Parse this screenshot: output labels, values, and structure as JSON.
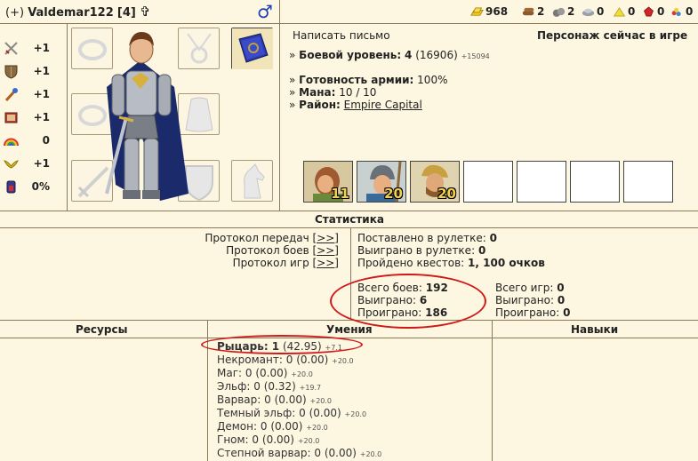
{
  "header": {
    "prefix": "(+)",
    "name": "Valdemar122",
    "level": "[4]",
    "cross": "✞",
    "gender": "♂"
  },
  "resources_top": [
    {
      "icon": "gold-icon",
      "value": "968"
    },
    {
      "icon": "wood-icon",
      "value": "2"
    },
    {
      "icon": "ore-icon",
      "value": "2"
    },
    {
      "icon": "mercury-icon",
      "value": "0"
    },
    {
      "icon": "sulfur-icon",
      "value": "0"
    },
    {
      "icon": "crystal-icon",
      "value": "0"
    },
    {
      "icon": "gems-icon",
      "value": "0"
    }
  ],
  "stats": [
    {
      "icon": "attack-icon",
      "value": "+1"
    },
    {
      "icon": "defense-icon",
      "value": "+1"
    },
    {
      "icon": "spellpower-icon",
      "value": "+1"
    },
    {
      "icon": "knowledge-icon",
      "value": "+1"
    },
    {
      "icon": "luck-icon",
      "value": "0"
    },
    {
      "icon": "morale-icon",
      "value": "+1"
    },
    {
      "icon": "initiative-icon",
      "value": "0%"
    }
  ],
  "info": {
    "write_letter": "Написать письмо",
    "online_status": "Персонаж сейчас в игре",
    "combat_level_label": "Боевой уровень:",
    "combat_level_value": "4",
    "combat_level_exp": "(16906)",
    "combat_level_next": "+15094",
    "army_ready_label": "Готовность армии:",
    "army_ready_value": "100%",
    "mana_label": "Мана:",
    "mana_value": "10 / 10",
    "district_label": "Район:",
    "district_value": "Empire Capital"
  },
  "army": [
    {
      "icon": "archer-unit-icon",
      "count": "11"
    },
    {
      "icon": "spearman-unit-icon",
      "count": "20"
    },
    {
      "icon": "peasant-unit-icon",
      "count": "20"
    },
    {
      "icon": "",
      "count": ""
    },
    {
      "icon": "",
      "count": ""
    },
    {
      "icon": "",
      "count": ""
    },
    {
      "icon": "",
      "count": ""
    }
  ],
  "statistics": {
    "title": "Статистика",
    "transfer_log": "Протокол передач",
    "battle_log": "Протокол боев",
    "game_log": "Протокол игр",
    "log_link": "[>>]",
    "roulette_bet_label": "Поставлено в рулетке:",
    "roulette_bet_value": "0",
    "roulette_won_label": "Выиграно в рулетке:",
    "roulette_won_value": "0",
    "quests_label": "Пройдено квестов:",
    "quests_value": "1, 100 очков",
    "battles_total_label": "Всего боев:",
    "battles_total_value": "192",
    "battles_won_label": "Выиграно:",
    "battles_won_value": "6",
    "battles_lost_label": "Проиграно:",
    "battles_lost_value": "186",
    "games_total_label": "Всего игр:",
    "games_total_value": "0",
    "games_won_label": "Выиграно:",
    "games_won_value": "0",
    "games_lost_label": "Проиграно:",
    "games_lost_value": "0"
  },
  "sections": {
    "resources": "Ресурсы",
    "skills": "Умения",
    "talents": "Навыки"
  },
  "skills": [
    {
      "name": "Рыцарь: 1",
      "value": "(42.95)",
      "extra": "+7.1",
      "bold": true
    },
    {
      "name": "Некромант: 0",
      "value": "(0.00)",
      "extra": "+20.0",
      "bold": false
    },
    {
      "name": "Маг: 0",
      "value": "(0.00)",
      "extra": "+20.0",
      "bold": false
    },
    {
      "name": "Эльф: 0",
      "value": "(0.32)",
      "extra": "+19.7",
      "bold": false
    },
    {
      "name": "Варвар: 0",
      "value": "(0.00)",
      "extra": "+20.0",
      "bold": false
    },
    {
      "name": "Темный эльф: 0",
      "value": "(0.00)",
      "extra": "+20.0",
      "bold": false
    },
    {
      "name": "Демон: 0",
      "value": "(0.00)",
      "extra": "+20.0",
      "bold": false
    },
    {
      "name": "Гном: 0",
      "value": "(0.00)",
      "extra": "+20.0",
      "bold": false
    },
    {
      "name": "Степной варвар: 0",
      "value": "(0.00)",
      "extra": "+20.0",
      "bold": false
    }
  ]
}
